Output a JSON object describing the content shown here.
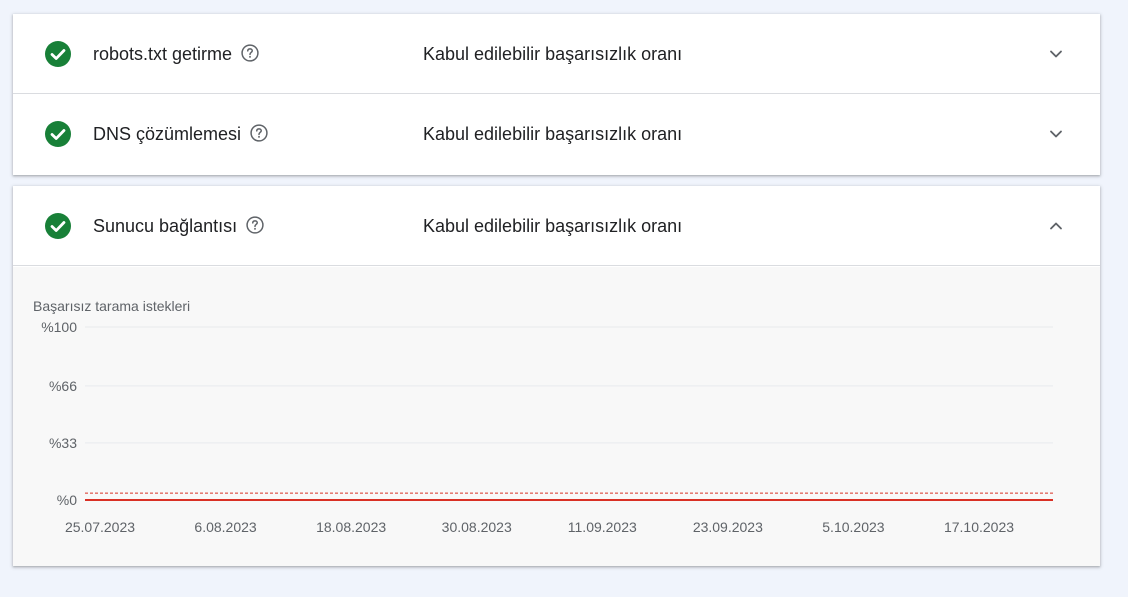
{
  "rows": [
    {
      "title": "robots.txt getirme",
      "status": "Kabul edilebilir başarısızlık oranı",
      "expanded": false
    },
    {
      "title": "DNS çözümlemesi",
      "status": "Kabul edilebilir başarısızlık oranı",
      "expanded": false
    },
    {
      "title": "Sunucu bağlantısı",
      "status": "Kabul edilebilir başarısızlık oranı",
      "expanded": true
    }
  ],
  "icons": {
    "status": "check-circle-icon",
    "help": "help-circle-icon",
    "collapsed": "chevron-down-icon",
    "expanded": "chevron-up-icon"
  },
  "colors": {
    "success": "#188038",
    "line": "#d93025",
    "threshold": "#d93025",
    "page_background": "#f0f4fc"
  },
  "chart_data": {
    "type": "line",
    "title": "Başarısız tarama istekleri",
    "ylabel": "",
    "xlabel": "",
    "y_ticks": [
      "%100",
      "%66",
      "%33",
      "%0"
    ],
    "y_tick_values": [
      100,
      66,
      33,
      0
    ],
    "ylim": [
      0,
      100
    ],
    "x_ticks": [
      "25.07.2023",
      "6.08.2023",
      "18.08.2023",
      "30.08.2023",
      "11.09.2023",
      "23.09.2023",
      "5.10.2023",
      "17.10.2023"
    ],
    "x_range": [
      "25.07.2023",
      "17.10.2023"
    ],
    "series_values_percent": 0,
    "threshold_percent": 4,
    "grid": true
  }
}
